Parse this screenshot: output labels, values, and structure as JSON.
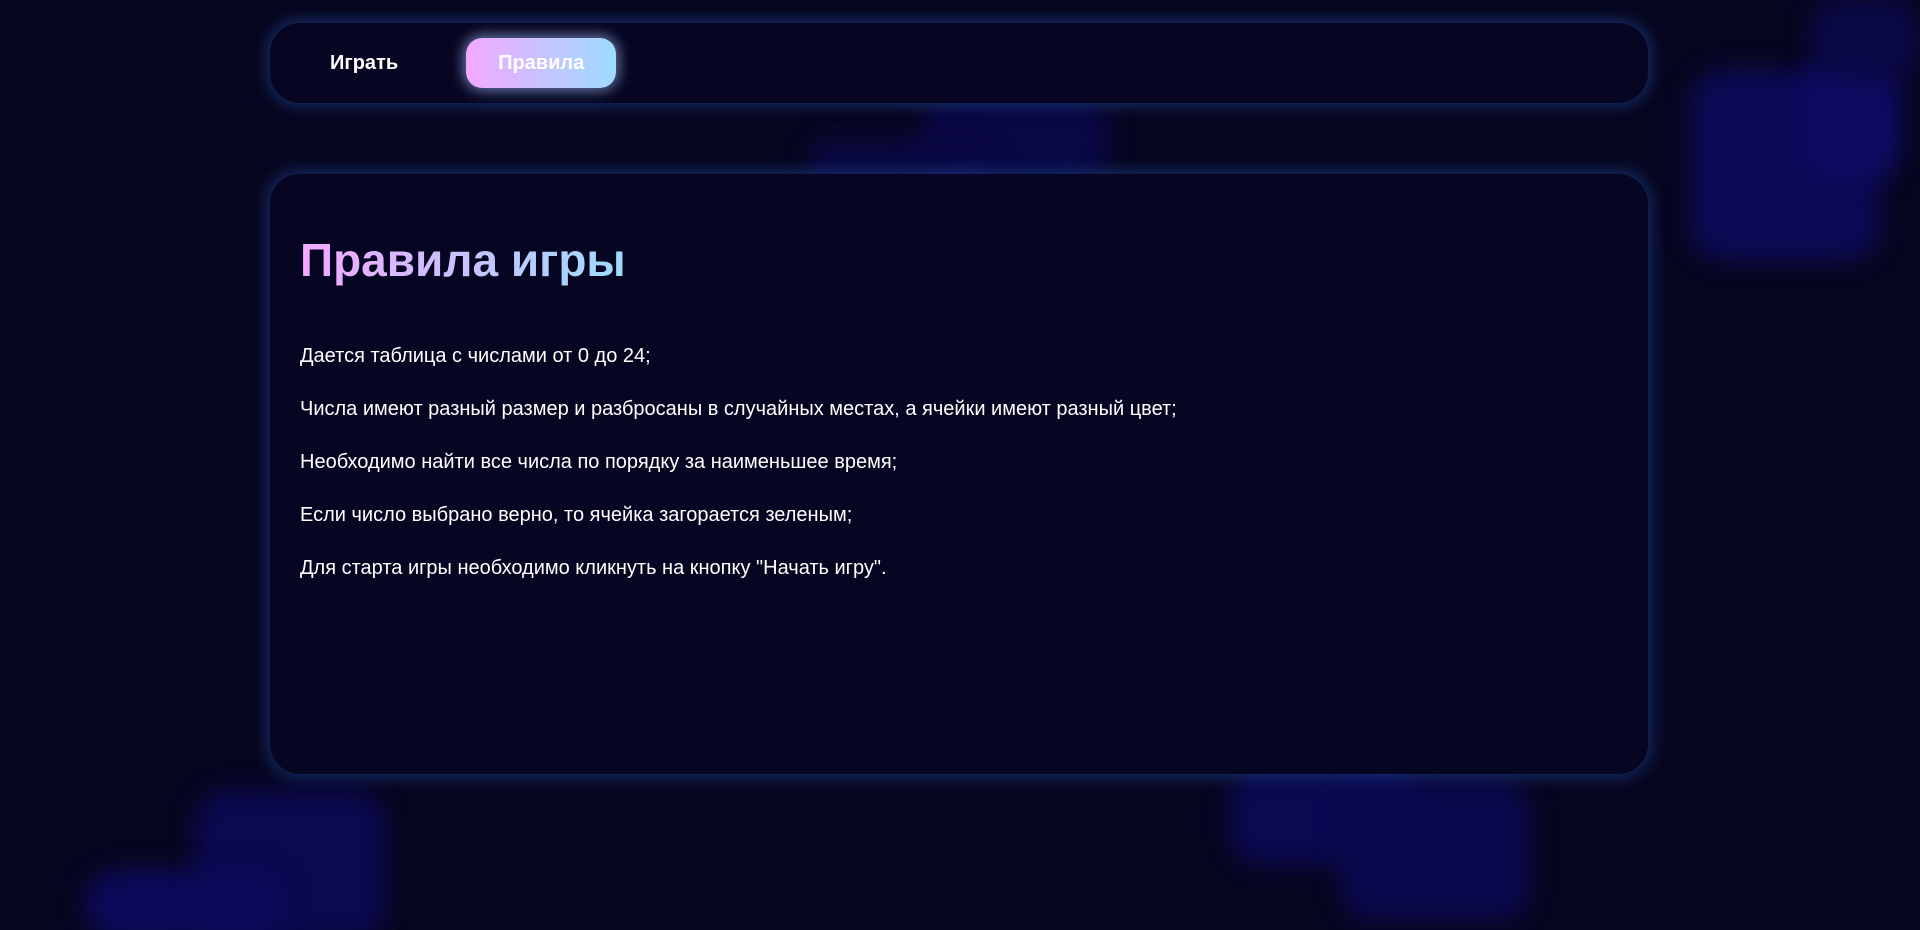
{
  "nav": {
    "items": [
      {
        "label": "Играть",
        "active": false
      },
      {
        "label": "Правила",
        "active": true
      }
    ]
  },
  "rules": {
    "title": "Правила игры",
    "items": [
      "Дается таблица с числами от 0 до 24;",
      "Числа имеют разный размер и разбросаны в случайных местах, а ячейки имеют разный цвет;",
      "Необходимо найти все числа по порядку за наименьшее время;",
      "Если число выбрано верно, то ячейка загорается зеленым;",
      "Для старта игры необходимо кликнуть на кнопку \"Начать игру\"."
    ]
  },
  "colors": {
    "background": "#070620",
    "panel": "#060522",
    "accent_gradient_start": "#f3a8ff",
    "accent_gradient_end": "#9edcff",
    "glow": "#285fbe",
    "decor_square": "#0c0a5a"
  }
}
